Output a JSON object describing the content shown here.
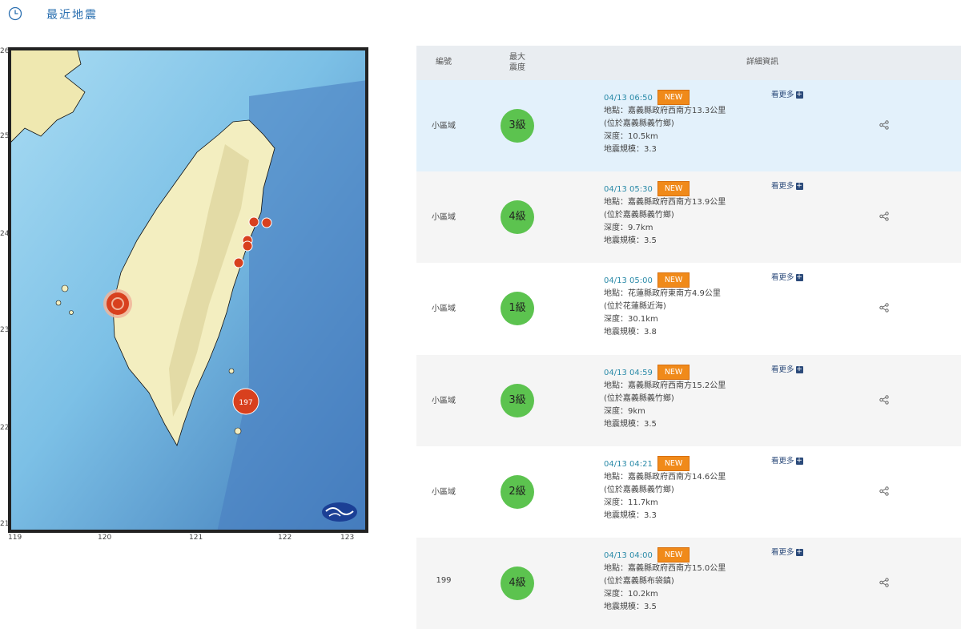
{
  "header": {
    "title": "最近地震",
    "clock_icon": "clock-icon"
  },
  "map": {
    "lat_labels": [
      "26",
      "25",
      "24",
      "23",
      "22",
      "21"
    ],
    "lon_labels": [
      "119",
      "120",
      "121",
      "122",
      "123"
    ],
    "big_marker_label": "197",
    "logo_icon": "cwb-logo-icon"
  },
  "table": {
    "headers": {
      "id": "編號",
      "mag_line1": "最大",
      "mag_line2": "震度",
      "detail": "詳細資訊"
    },
    "more_label": "看更多",
    "new_label": "NEW",
    "rows": [
      {
        "id": "小區域",
        "intensity": "3級",
        "time": "04/13 06:50",
        "location": "地點：嘉義縣政府西南方13.3公里",
        "sub": "(位於嘉義縣義竹鄉)",
        "depth": "深度：10.5km",
        "magnitude": "地震規模：3.3"
      },
      {
        "id": "小區域",
        "intensity": "4級",
        "time": "04/13 05:30",
        "location": "地點：嘉義縣政府西南方13.9公里",
        "sub": "(位於嘉義縣義竹鄉)",
        "depth": "深度：9.7km",
        "magnitude": "地震規模：3.5"
      },
      {
        "id": "小區域",
        "intensity": "1級",
        "time": "04/13 05:00",
        "location": "地點：花蓮縣政府東南方4.9公里",
        "sub": "(位於花蓮縣近海)",
        "depth": "深度：30.1km",
        "magnitude": "地震規模：3.8"
      },
      {
        "id": "小區域",
        "intensity": "3級",
        "time": "04/13 04:59",
        "location": "地點：嘉義縣政府西南方15.2公里",
        "sub": "(位於嘉義縣義竹鄉)",
        "depth": "深度：9km",
        "magnitude": "地震規模：3.5"
      },
      {
        "id": "小區域",
        "intensity": "2級",
        "time": "04/13 04:21",
        "location": "地點：嘉義縣政府西南方14.6公里",
        "sub": "(位於嘉義縣義竹鄉)",
        "depth": "深度：11.7km",
        "magnitude": "地震規模：3.3"
      },
      {
        "id": "199",
        "intensity": "4級",
        "time": "04/13 04:00",
        "location": "地點：嘉義縣政府西南方15.0公里",
        "sub": "(位於嘉義縣布袋鎮)",
        "depth": "深度：10.2km",
        "magnitude": "地震規模：3.5"
      }
    ]
  }
}
